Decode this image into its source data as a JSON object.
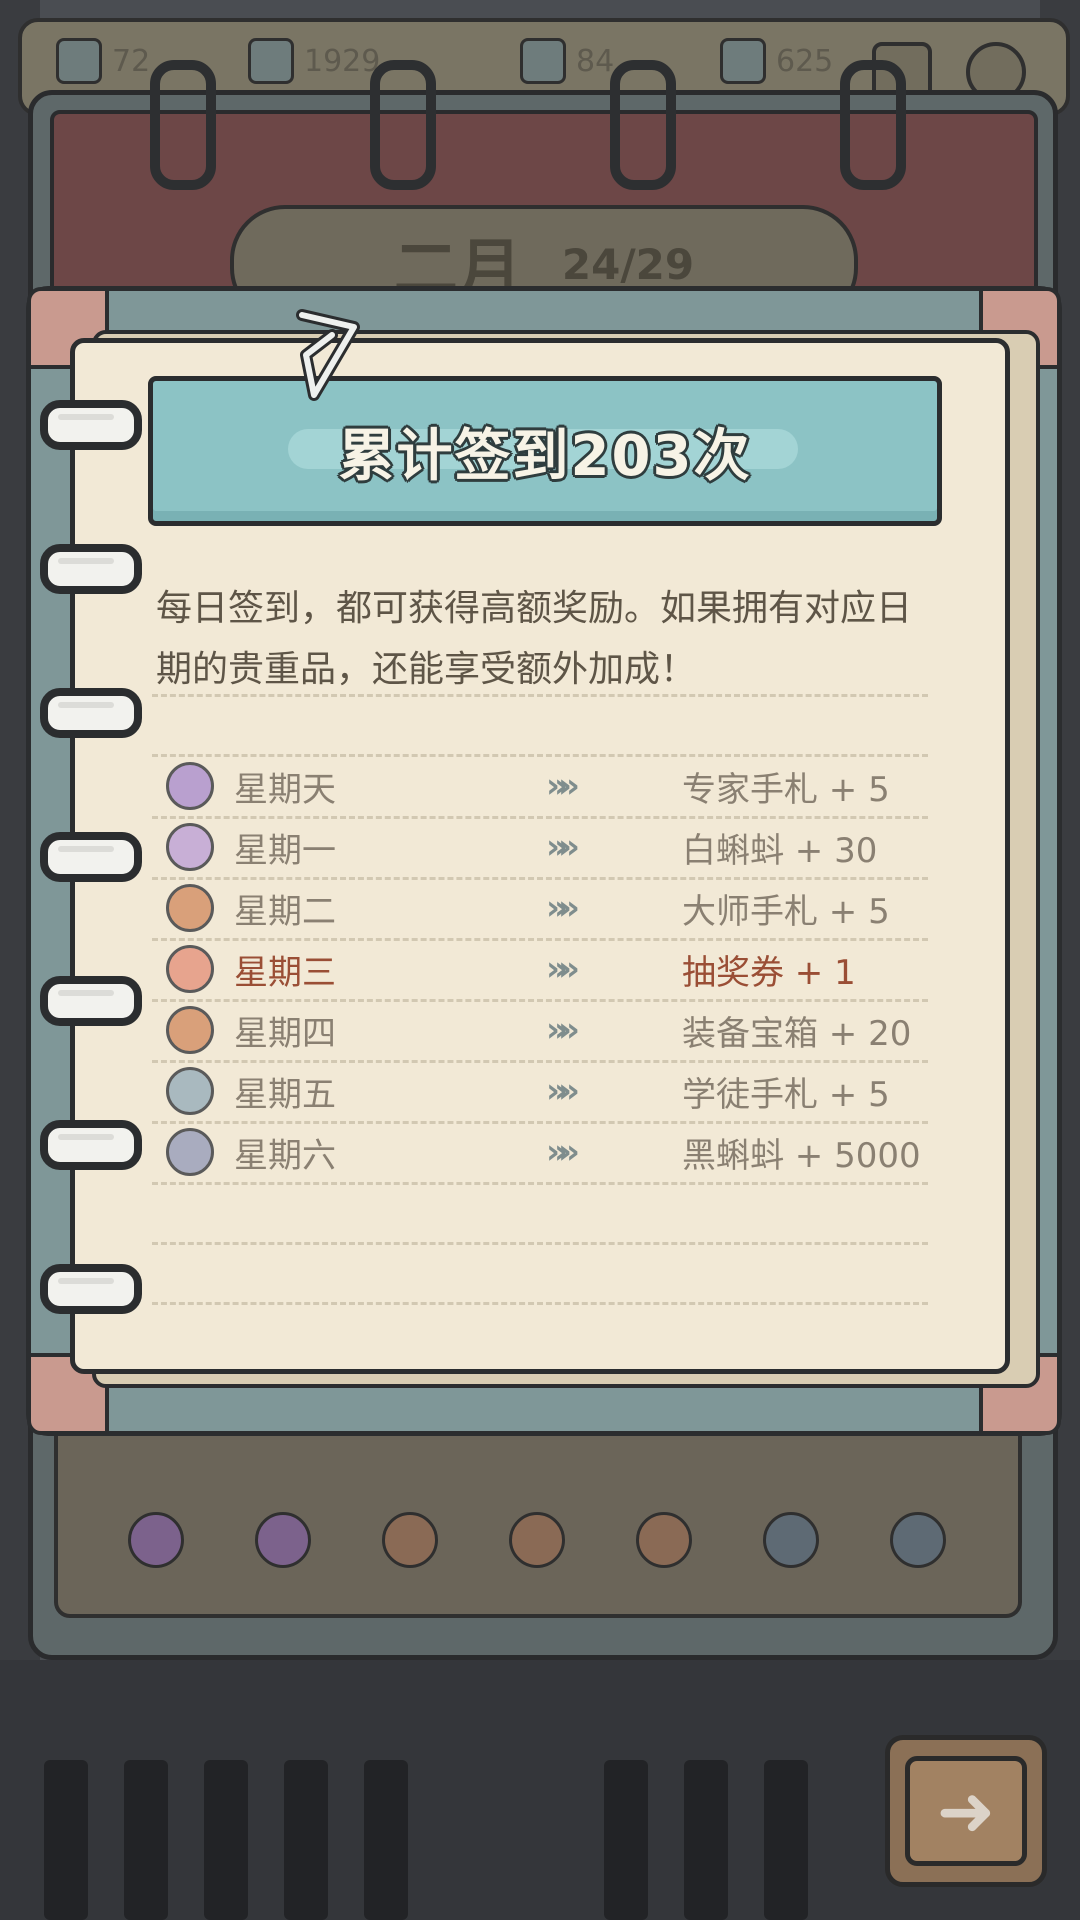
{
  "resources": [
    {
      "icon": "ink-pot-icon",
      "value": "72"
    },
    {
      "icon": "ink-pot-icon",
      "value": "1929"
    },
    {
      "icon": "ink-pot-icon",
      "value": "84"
    },
    {
      "icon": "ink-pot-icon",
      "value": "625"
    }
  ],
  "calendar": {
    "month": "二月",
    "day_progress": "24/29"
  },
  "dialog": {
    "title": "累计签到203次",
    "description": "每日签到，都可获得高额奖励。如果拥有对应日期的贵重品，还能享受额外加成！",
    "arrow_glyph": "»",
    "rows": [
      {
        "day": "星期天",
        "reward": "专家手札  + 5",
        "icon_color": "#b9a0cf",
        "icon": "hammer-icon",
        "highlight": false
      },
      {
        "day": "星期一",
        "reward": "白蝌蚪  + 30",
        "icon_color": "#c8afd6",
        "icon": "tadpole-icon",
        "highlight": false
      },
      {
        "day": "星期二",
        "reward": "大师手札  + 5",
        "icon_color": "#d9a07a",
        "icon": "tools-icon",
        "highlight": false
      },
      {
        "day": "星期三",
        "reward": "抽奖券  + 1",
        "icon_color": "#e7a48e",
        "icon": "ticket-icon",
        "highlight": true
      },
      {
        "day": "星期四",
        "reward": "装备宝箱  + 20",
        "icon_color": "#d9a07a",
        "icon": "chest-icon",
        "highlight": false
      },
      {
        "day": "星期五",
        "reward": "学徒手札  + 5",
        "icon_color": "#a9b9bf",
        "icon": "wrench-icon",
        "highlight": false
      },
      {
        "day": "星期六",
        "reward": "黑蝌蚪  + 5000",
        "icon_color": "#a9acbf",
        "icon": "tadpole-icon",
        "highlight": false
      }
    ]
  },
  "week_icons": [
    {
      "icon": "hammer-icon",
      "color": "#7c628c"
    },
    {
      "icon": "tadpole-icon",
      "color": "#7c628c"
    },
    {
      "icon": "tools-icon",
      "color": "#8a6a55"
    },
    {
      "icon": "ticket-icon",
      "color": "#8a6a55"
    },
    {
      "icon": "chest-icon",
      "color": "#8a6a55"
    },
    {
      "icon": "wrench-icon",
      "color": "#5e6a74"
    },
    {
      "icon": "tadpole-icon",
      "color": "#5e6a74"
    }
  ],
  "next_button": {
    "glyph": "➜"
  }
}
